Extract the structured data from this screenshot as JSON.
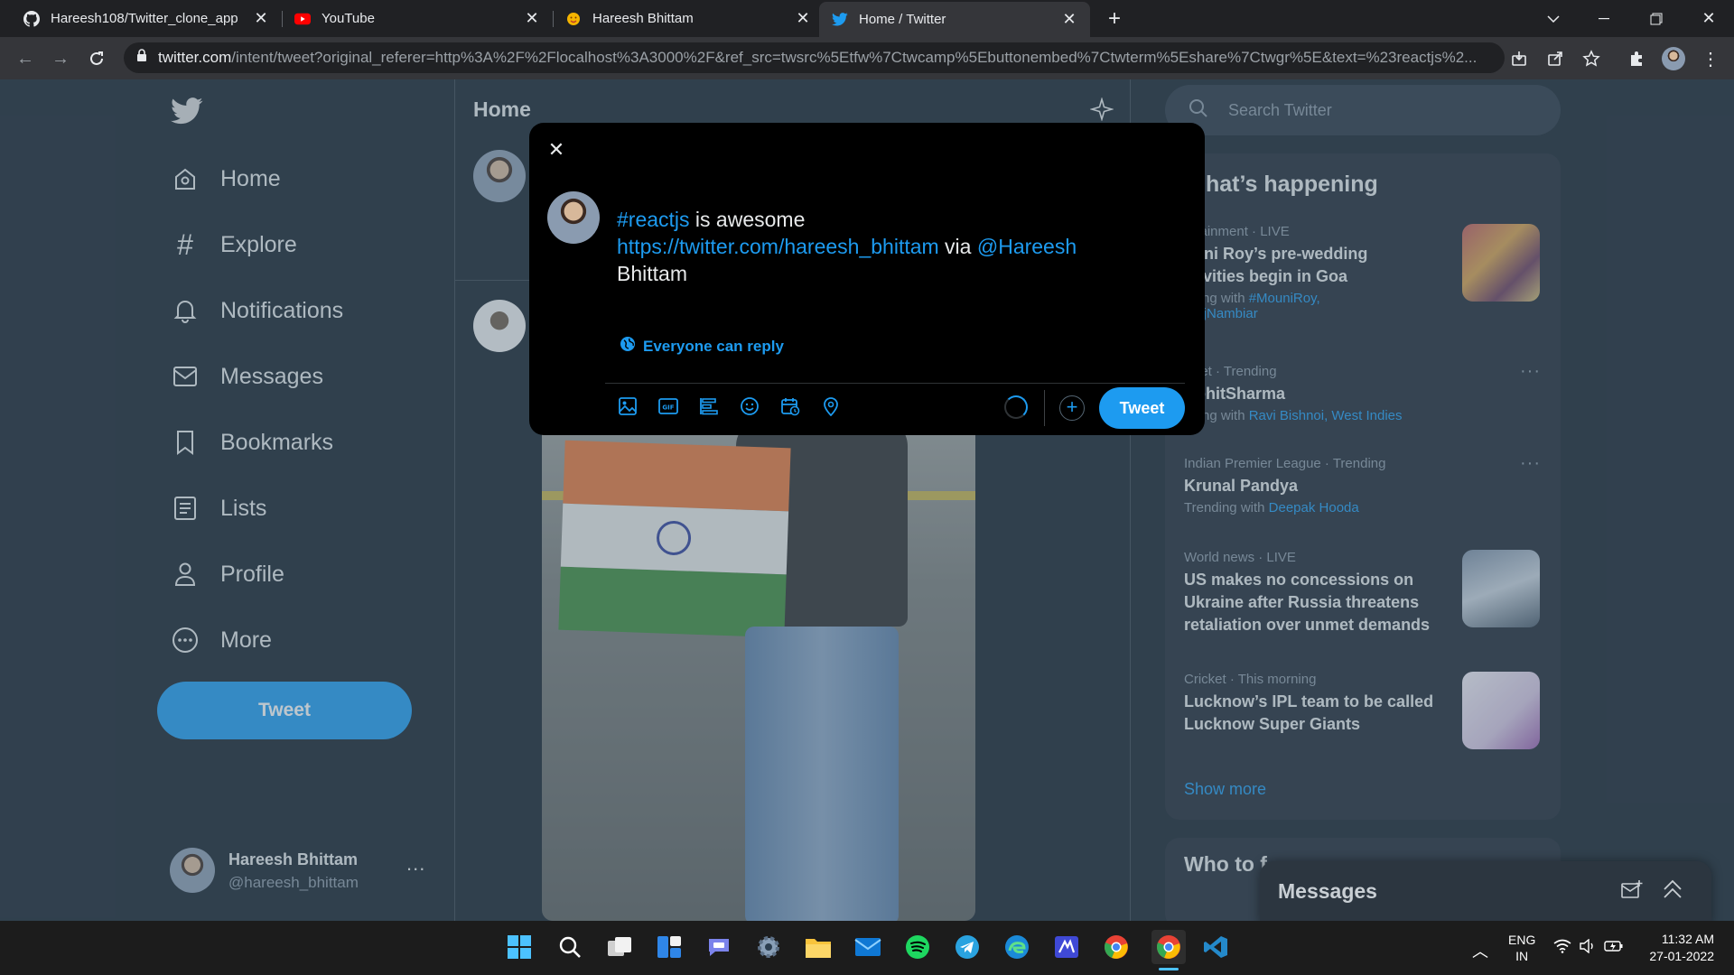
{
  "browser": {
    "tabs": [
      {
        "title": "Hareesh108/Twitter_clone_app",
        "icon": "github-icon"
      },
      {
        "title": "YouTube",
        "icon": "youtube-icon"
      },
      {
        "title": "Hareesh Bhittam",
        "icon": "smiley-icon"
      },
      {
        "title": "Home / Twitter",
        "icon": "twitter-bird-icon"
      }
    ],
    "url_domain": "twitter.com",
    "url_path": "/intent/tweet?original_referer=http%3A%2F%2Flocalhost%3A3000%2F&ref_src=twsrc%5Etfw%7Ctwcamp%5Ebuttonembed%7Ctwterm%5Eshare%7Ctwgr%5E&text=%23reactjs%2..."
  },
  "sidebar": {
    "items": [
      {
        "label": "Home"
      },
      {
        "label": "Explore"
      },
      {
        "label": "Notifications"
      },
      {
        "label": "Messages"
      },
      {
        "label": "Bookmarks"
      },
      {
        "label": "Lists"
      },
      {
        "label": "Profile"
      },
      {
        "label": "More"
      }
    ],
    "tweet_label": "Tweet",
    "user": {
      "name": "Hareesh Bhittam",
      "handle": "@hareesh_bhittam",
      "more": "..."
    }
  },
  "timeline": {
    "title": "Home"
  },
  "search": {
    "placeholder": "Search Twitter"
  },
  "trends": {
    "title": "hat’s happening",
    "items": [
      {
        "meta": "ertainment · LIVE",
        "line1": "ouni Roy’s pre-wedding",
        "line2": "stivities begin in Goa",
        "with_prefix": "nding with ",
        "with_tags": "#MouniRoy,",
        "with_line2": "urajNambiar"
      },
      {
        "meta": "icket · Trending",
        "line1": "RohitSharma",
        "with_prefix": "nding with ",
        "with_tags": "Ravi Bishnoi, West Indies"
      },
      {
        "meta": "Indian Premier League · Trending",
        "line1": "Krunal Pandya",
        "with_prefix": "Trending with ",
        "with_tags": "Deepak Hooda"
      },
      {
        "meta": "World news · LIVE",
        "line1": "US makes no concessions on",
        "line2": "Ukraine after Russia threatens",
        "line3": "retaliation over unmet demands"
      },
      {
        "meta": "Cricket · This morning",
        "line1": "Lucknow’s IPL team to be called",
        "line2": "Lucknow Super Giants"
      }
    ],
    "show_more": "Show more",
    "who_to_follow": "Who to f..."
  },
  "messages_drawer": {
    "title": "Messages"
  },
  "composer": {
    "hashtag": "#reactjs",
    "text1": " is awesome",
    "link": "https://twitter.com/hareesh_bhittam",
    "via": " via ",
    "mention": "@Hareesh",
    "text2": "Bhittam",
    "reply_setting": "Everyone can reply",
    "tweet_button": "Tweet"
  },
  "system_tray": {
    "lang1": "ENG",
    "lang2": "IN",
    "time": "11:32 AM",
    "date": "27-01-2022"
  },
  "colors": {
    "accent": "#1d9bf0",
    "background": "#15202b",
    "modal": "#000000"
  }
}
